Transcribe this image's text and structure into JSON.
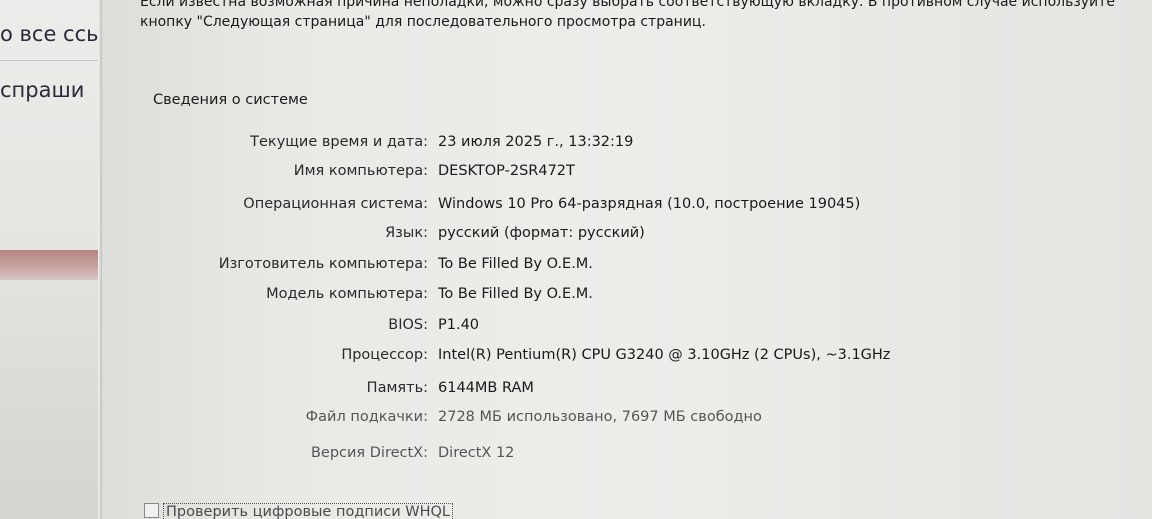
{
  "background_window": {
    "line1": "о все ссы",
    "line2": "спраши"
  },
  "dialog": {
    "intro_line1": "Если известна возможная причина неполадки, можно сразу выбрать соответствующую вкладку. В противном случае используйте",
    "intro_line2": "кнопку \"Следующая страница\" для последовательного просмотра страниц.",
    "section_title": "Сведения о системе",
    "system_info": [
      {
        "label": "Текущие время и дата:",
        "value": "23 июля 2025 г., 13:32:19"
      },
      {
        "label": "Имя компьютера:",
        "value": "DESKTOP-2SR472T"
      },
      {
        "label": "Операционная система:",
        "value": "Windows 10 Pro 64-разрядная (10.0, построение 19045)"
      },
      {
        "label": "Язык:",
        "value": "русский (формат: русский)"
      },
      {
        "label": "Изготовитель компьютера:",
        "value": "To Be Filled By O.E.M."
      },
      {
        "label": "Модель компьютера:",
        "value": "To Be Filled By O.E.M."
      },
      {
        "label": "BIOS:",
        "value": "P1.40"
      },
      {
        "label": "Процессор:",
        "value": "Intel(R) Pentium(R) CPU G3240 @ 3.10GHz (2 CPUs), ~3.1GHz"
      },
      {
        "label": "Память:",
        "value": "6144MB RAM"
      },
      {
        "label": "Файл подкачки:",
        "value": "2728 МБ использовано, 7697 МБ свободно"
      },
      {
        "label": "Версия DirectX:",
        "value": "DirectX 12"
      }
    ],
    "whql_checkbox_label": "Проверить цифровые подписи WHQL"
  }
}
